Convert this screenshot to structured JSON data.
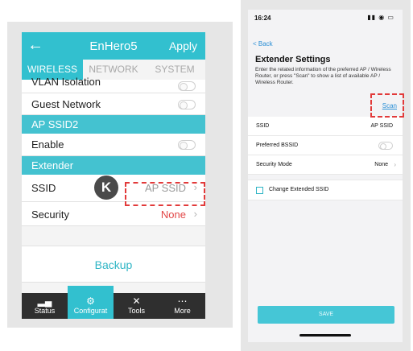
{
  "left_app": {
    "header": {
      "back_icon": "arrow-left-icon",
      "title": "EnHero5",
      "apply_label": "Apply"
    },
    "tabs": [
      {
        "label": "WIRELESS",
        "active": true
      },
      {
        "label": "NETWORK",
        "active": false
      },
      {
        "label": "SYSTEM",
        "active": false
      }
    ],
    "rows": {
      "vlan_isolation": "VLAN Isolation",
      "guest_network": "Guest Network",
      "section_ap_ssid2": "AP SSID2",
      "enable": "Enable",
      "section_extender": "Extender",
      "ssid_label": "SSID",
      "ssid_value": "AP SSID",
      "security_label": "Security",
      "security_value": "None"
    },
    "backup_label": "Backup",
    "marker_label": "K",
    "bottom_nav": [
      {
        "label": "Status",
        "icon": "chart-icon",
        "active": false
      },
      {
        "label": "Configurat",
        "icon": "gear-icon",
        "active": true
      },
      {
        "label": "Tools",
        "icon": "tools-icon",
        "active": false
      },
      {
        "label": "More",
        "icon": "more-dots-icon",
        "active": false
      }
    ],
    "colors": {
      "accent": "#32c0cf",
      "highlight": "#e23a3a",
      "value_red": "#e24747",
      "nav_bg": "#2f2f2f"
    }
  },
  "right_app": {
    "status_time": "16:24",
    "back_label": "< Back",
    "title": "Extender Settings",
    "description": "Enter the related information of the preferred AP / Wireless Router, or press \"Scan\" to show a list of available AP / Wireless Router.",
    "scan_label": "Scan",
    "rows": {
      "ssid_label": "SSID",
      "ssid_value": "AP SSID",
      "bssid_label": "Preferred BSSID",
      "security_label": "Security Mode",
      "security_value": "None"
    },
    "change_ssid_label": "Change Extended SSID",
    "save_label": "SAVE",
    "colors": {
      "link": "#2b8fd6",
      "save_bg": "#45c6d6"
    }
  }
}
